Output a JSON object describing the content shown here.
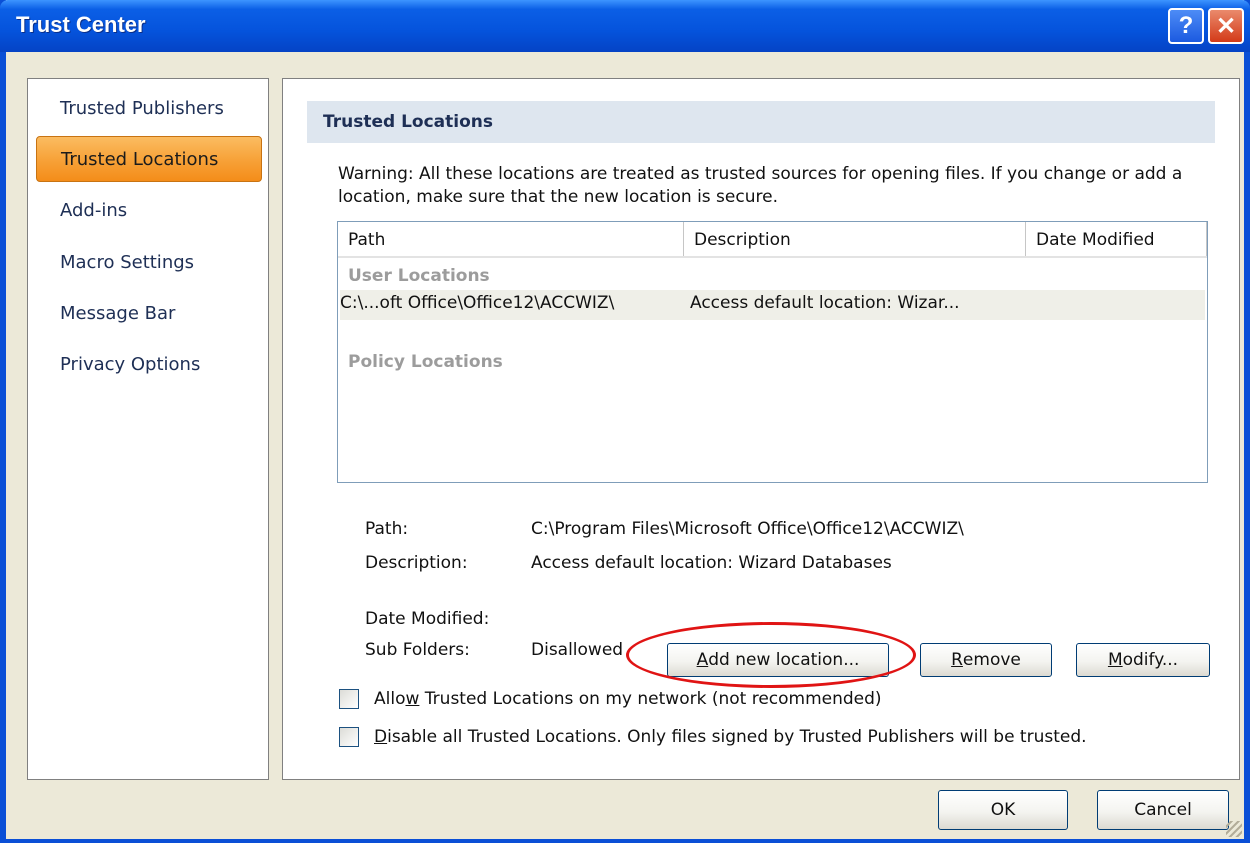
{
  "window": {
    "title": "Trust Center",
    "help_glyph": "?",
    "close_glyph": "✕"
  },
  "nav": {
    "items": [
      {
        "label": "Trusted Publishers",
        "active": false
      },
      {
        "label": "Trusted Locations",
        "active": true
      },
      {
        "label": "Add-ins",
        "active": false
      },
      {
        "label": "Macro Settings",
        "active": false
      },
      {
        "label": "Message Bar",
        "active": false
      },
      {
        "label": "Privacy Options",
        "active": false
      }
    ]
  },
  "content": {
    "section_title": "Trusted Locations",
    "warning": "Warning: All these locations are treated as trusted sources for opening files.  If you change or add a location, make sure that the new location is secure.",
    "columns": [
      "Path",
      "Description",
      "Date Modified"
    ],
    "groups": {
      "user": "User Locations",
      "policy": "Policy Locations"
    },
    "rows": [
      {
        "path": "C:\\...oft Office\\Office12\\ACCWIZ\\",
        "description": "Access default location: Wizar...",
        "date_modified": ""
      }
    ],
    "details": {
      "path_label": "Path:",
      "path_value": "C:\\Program Files\\Microsoft Office\\Office12\\ACCWIZ\\",
      "description_label": "Description:",
      "description_value": "Access default location: Wizard Databases",
      "date_modified_label": "Date Modified:",
      "date_modified_value": "",
      "subfolders_label": "Sub Folders:",
      "subfolders_value": "Disallowed"
    },
    "buttons": {
      "add": {
        "pre": "",
        "key": "A",
        "post": "dd new location..."
      },
      "remove": {
        "pre": "",
        "key": "R",
        "post": "emove"
      },
      "modify": {
        "pre": "",
        "key": "M",
        "post": "odify..."
      }
    },
    "checkboxes": [
      {
        "pre": "Allo",
        "key": "w",
        "post": " Trusted Locations on my network (not recommended)",
        "checked": false
      },
      {
        "pre": "",
        "key": "D",
        "post": "isable all Trusted Locations. Only files signed by Trusted Publishers will be trusted.",
        "checked": false
      }
    ]
  },
  "footer": {
    "ok_label": "OK",
    "cancel_label": "Cancel"
  },
  "colors": {
    "titlebar": "#0553dc",
    "nav_active": "#f7a33a",
    "annotation_ellipse": "#e01414"
  }
}
